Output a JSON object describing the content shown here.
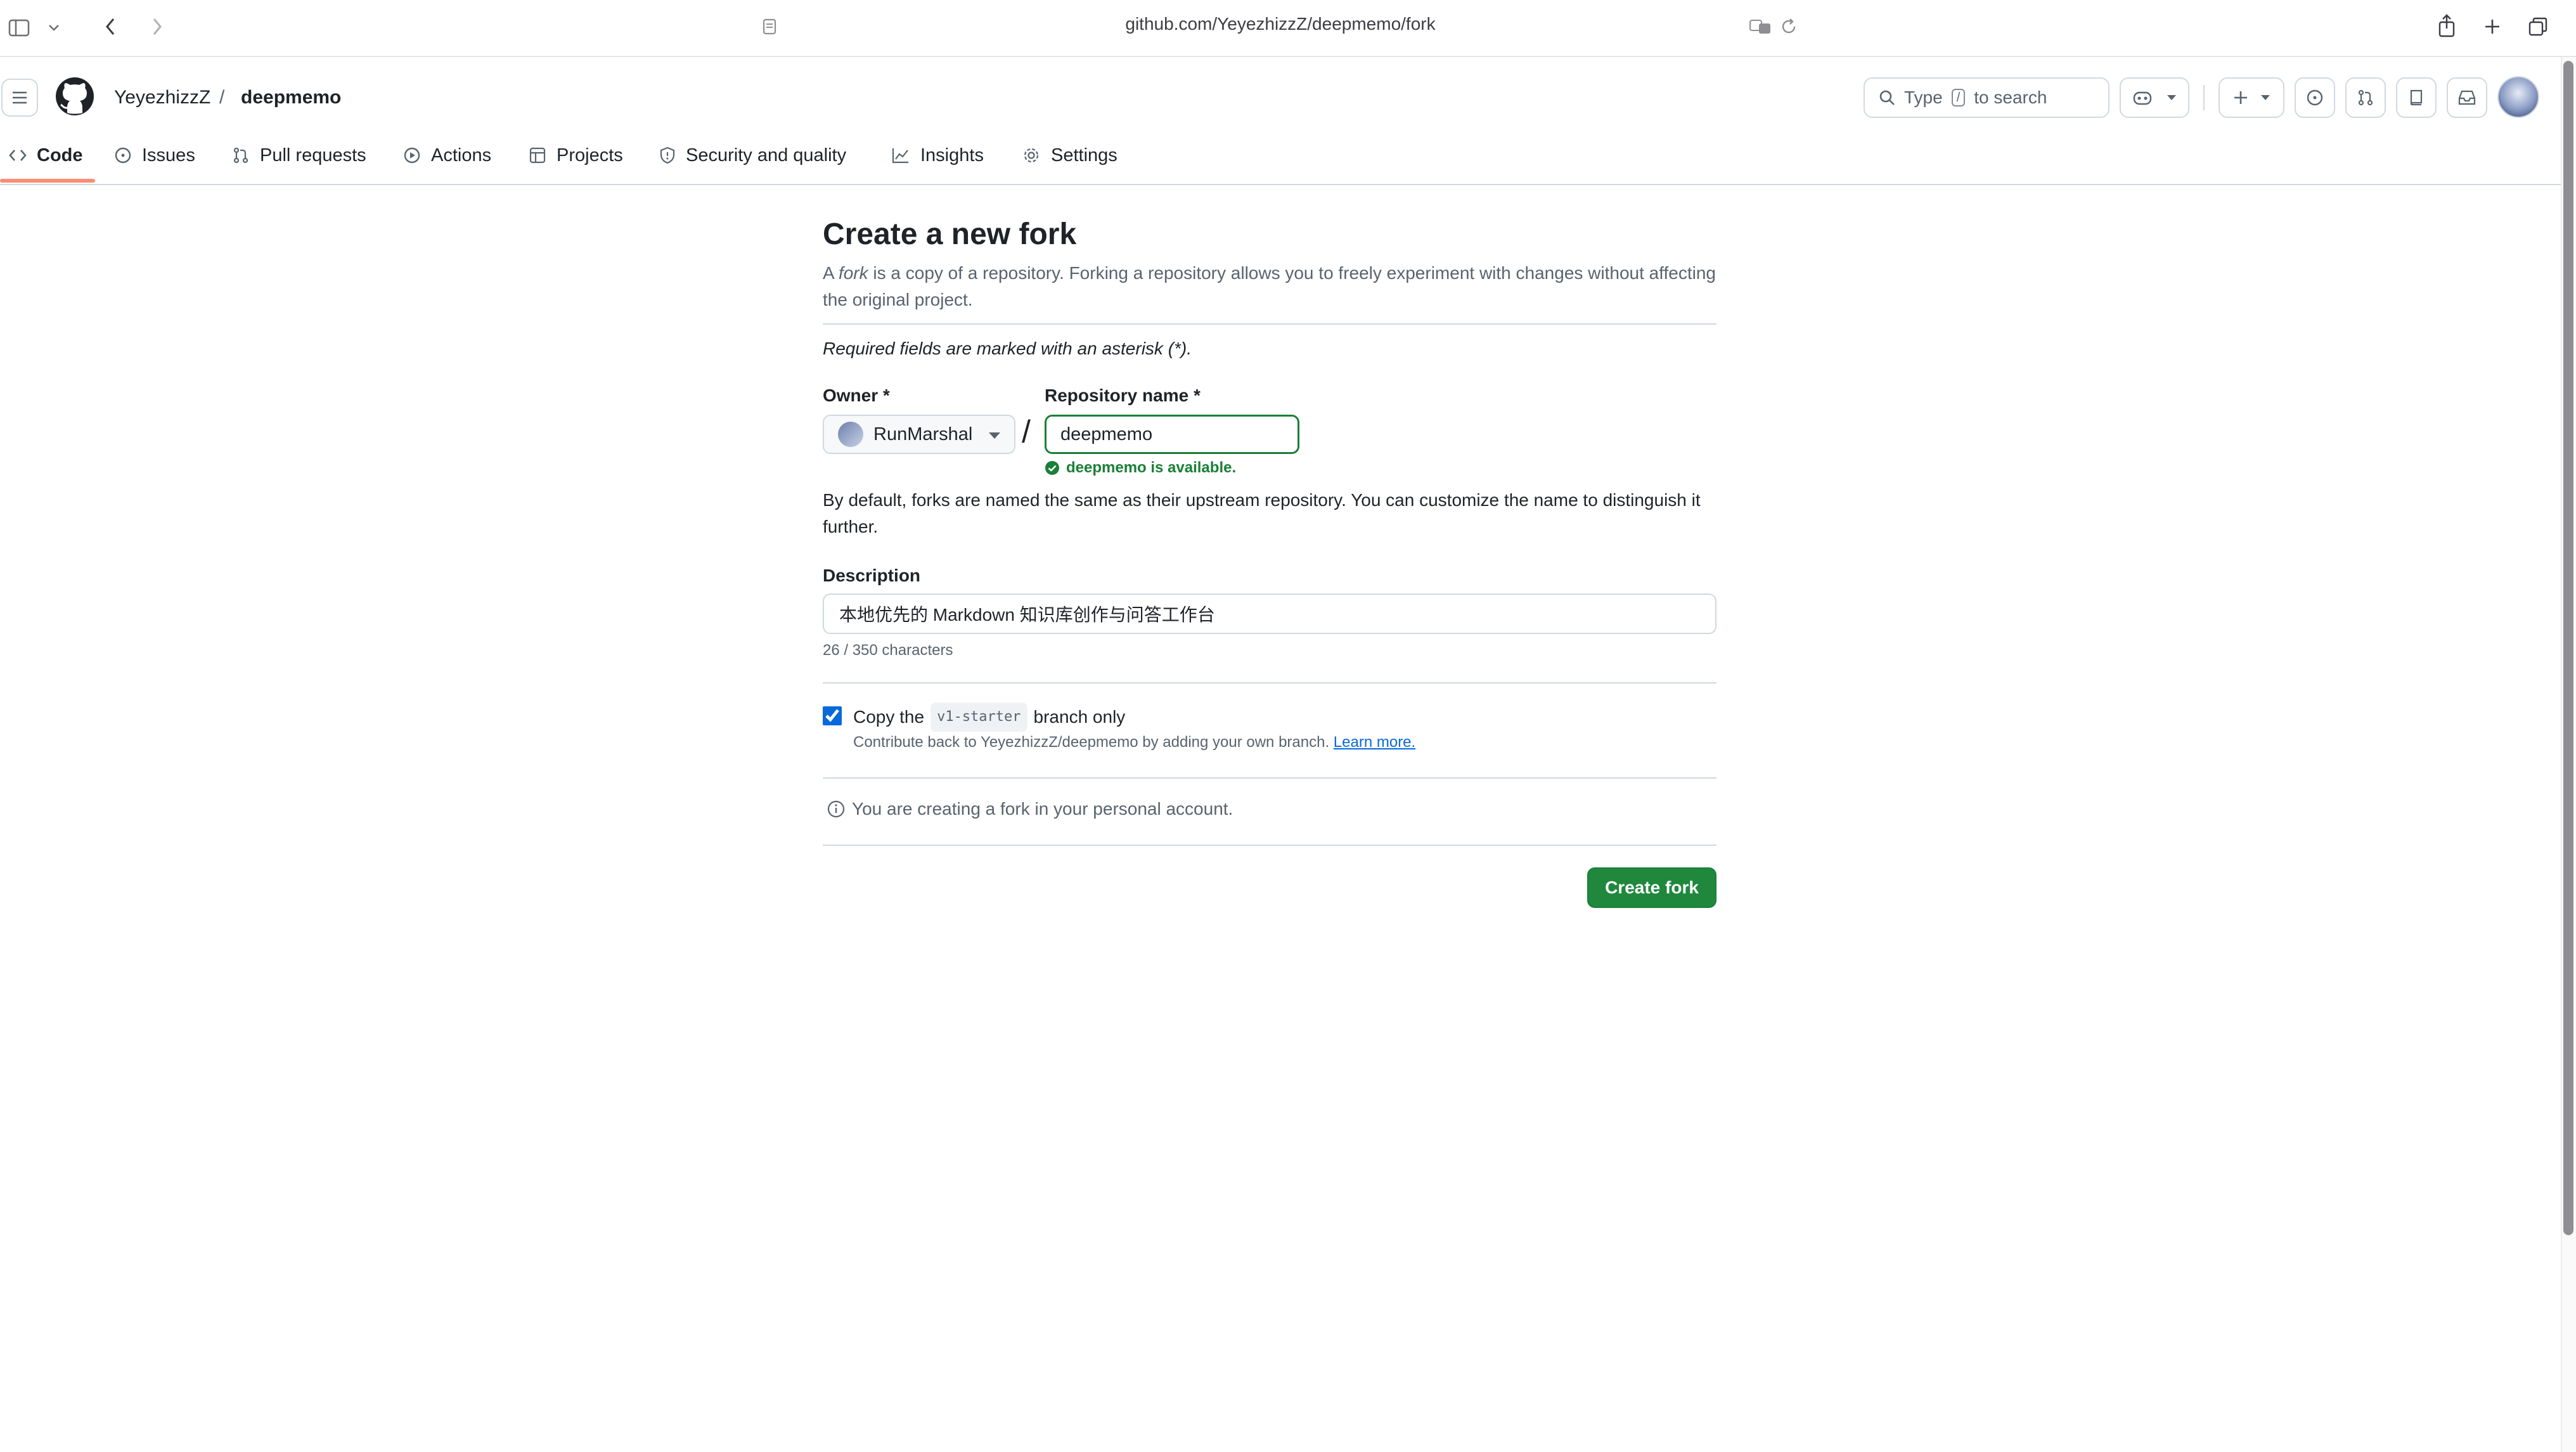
{
  "browser": {
    "url": "github.com/YeyezhizzZ/deepmemo/fork"
  },
  "header": {
    "owner": "YeyezhizzZ",
    "separator": "/",
    "repo": "deepmemo",
    "search_prefix": "Type",
    "search_key": "/",
    "search_suffix": "to search"
  },
  "tabs": [
    {
      "label": "Code",
      "icon": "code-icon",
      "active": true
    },
    {
      "label": "Issues",
      "icon": "issue-icon"
    },
    {
      "label": "Pull requests",
      "icon": "pull-request-icon"
    },
    {
      "label": "Actions",
      "icon": "play-icon"
    },
    {
      "label": "Projects",
      "icon": "table-icon"
    },
    {
      "label": "Security and quality",
      "icon": "shield-icon"
    },
    {
      "label": "Insights",
      "icon": "graph-icon"
    },
    {
      "label": "Settings",
      "icon": "gear-icon"
    }
  ],
  "form": {
    "title": "Create a new fork",
    "intro_prefix": "A ",
    "intro_em": "fork",
    "intro_suffix": " is a copy of a repository. Forking a repository allows you to freely experiment with changes without affecting the original project.",
    "required_note": "Required fields are marked with an asterisk (*).",
    "owner_label": "Owner *",
    "owner_value": "RunMarshal",
    "slash": "/",
    "repo_label": "Repository name *",
    "repo_value": "deepmemo",
    "available_text": "deepmemo is available.",
    "default_note": "By default, forks are named the same as their upstream repository. You can customize the name to distinguish it further.",
    "description_label": "Description",
    "description_value": "本地优先的 Markdown 知识库创作与问答工作台",
    "char_count": "26 / 350 characters",
    "copy_prefix": "Copy the",
    "copy_branch": "v1-starter",
    "copy_suffix": "branch only",
    "copy_checked": true,
    "contribute_text": "Contribute back to YeyezhizzZ/deepmemo by adding your own branch.",
    "learn_more": "Learn more.",
    "personal_note": "You are creating a fork in your personal account.",
    "create_button": "Create fork"
  },
  "colors": {
    "accent_green": "#1f883d",
    "success_text": "#1a7f37",
    "link_blue": "#0969da",
    "tab_underline": "#fd8c73"
  }
}
